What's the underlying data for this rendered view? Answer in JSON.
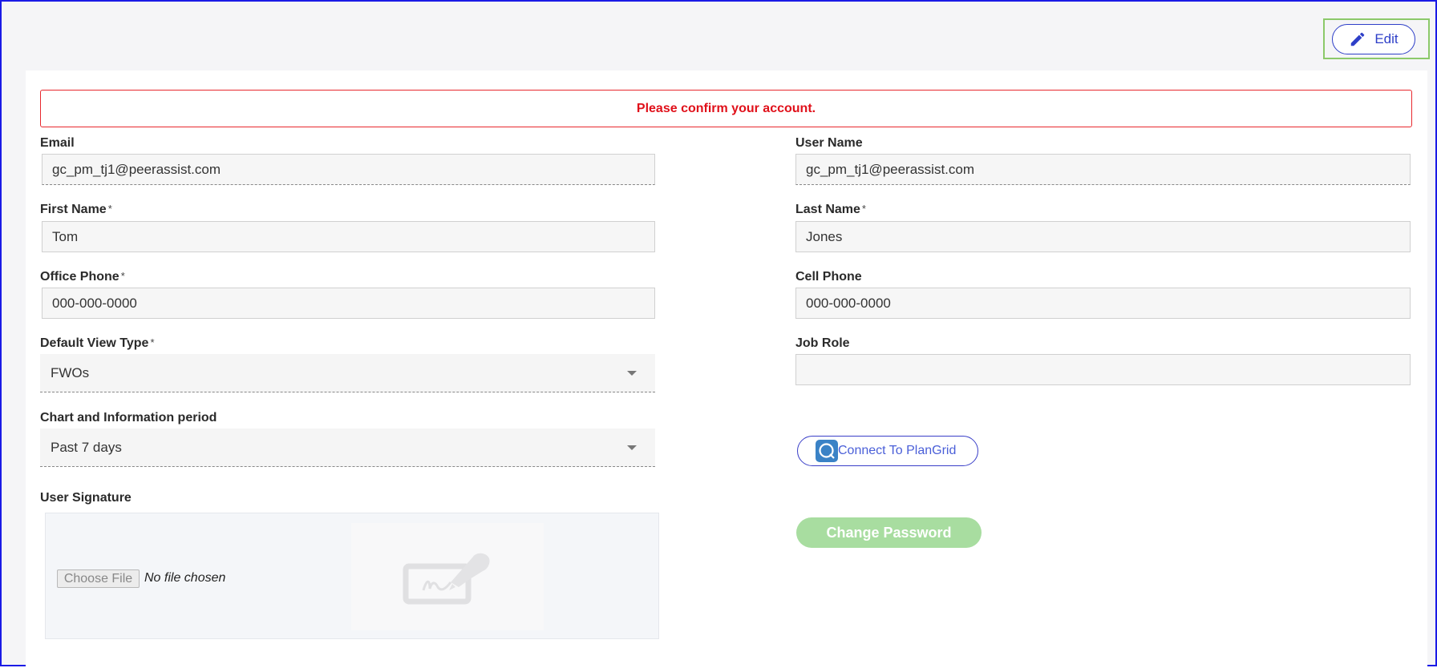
{
  "header": {
    "edit_label": "Edit"
  },
  "alert": {
    "message": "Please confirm your account."
  },
  "fields": {
    "email": {
      "label": "Email",
      "value": "gc_pm_tj1@peerassist.com"
    },
    "user_name": {
      "label": "User Name",
      "value": "gc_pm_tj1@peerassist.com"
    },
    "first_name": {
      "label": "First Name",
      "required": "*",
      "value": "Tom"
    },
    "last_name": {
      "label": "Last Name",
      "required": "*",
      "value": "Jones"
    },
    "office_phone": {
      "label": "Office Phone",
      "required": "*",
      "value": "000-000-0000"
    },
    "cell_phone": {
      "label": "Cell Phone",
      "value": "000-000-0000"
    },
    "default_view_type": {
      "label": "Default View Type",
      "required": "*",
      "value": "FWOs"
    },
    "job_role": {
      "label": "Job Role",
      "value": ""
    },
    "chart_period": {
      "label": "Chart and Information period",
      "value": "Past 7 days"
    },
    "user_signature": {
      "label": "User Signature",
      "choose_file_label": "Choose File",
      "file_status": "No file chosen"
    }
  },
  "actions": {
    "plangrid_label": "Connect To PlanGrid",
    "change_password_label": "Change Password"
  },
  "colors": {
    "accent": "#2e3fc8",
    "alert_red": "#e0101a",
    "password_green": "#a8dda0",
    "highlight_green": "#8cc96a"
  },
  "icons": {
    "edit": "pencil-icon",
    "select_caret": "caret-down-icon",
    "plangrid": "plangrid-logo-icon",
    "signature_placeholder": "signature-pad-icon"
  }
}
